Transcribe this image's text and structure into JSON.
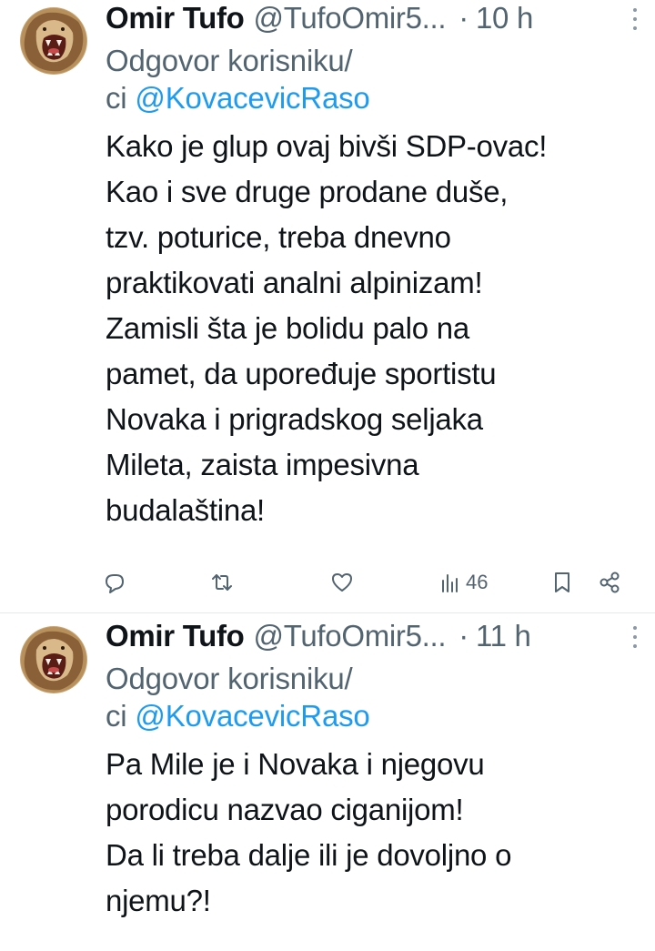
{
  "tweets": [
    {
      "author_name": "Omir Tufo",
      "handle": "@TufoOmir5...",
      "separator": "·",
      "time": "10 h",
      "reply_prefix": "Odgovor korisniku/",
      "reply_prefix2": "ci",
      "reply_mention": "@KovacevicRaso",
      "text": "Kako je glup ovaj bivši SDP-ovac!\nKao i sve druge prodane duše,\ntzv. poturice, treba dnevno\npraktikovati analni alpinizam!\nZamisli šta je bolidu palo na\npamet, da upoređuje sportistu\nNovaka i prigradskog seljaka\nMileta, zaista impesivna\nbudalaština!",
      "views": "46"
    },
    {
      "author_name": "Omir Tufo",
      "handle": "@TufoOmir5...",
      "separator": "·",
      "time": "11 h",
      "reply_prefix": "Odgovor korisniku/",
      "reply_prefix2": "ci",
      "reply_mention": "@KovacevicRaso",
      "text": "Pa Mile je i Novaka i njegovu\nporodicu nazvao ciganijom!\nDa li treba dalje ili je dovoljno o\nnjemu?!"
    }
  ],
  "icons": {
    "reply": "reply-icon",
    "retweet": "retweet-icon",
    "like": "heart-icon",
    "views": "views-icon",
    "bookmark": "bookmark-icon",
    "share": "share-icon",
    "more": "more-icon"
  },
  "colors": {
    "text": "#0f1419",
    "secondary": "#536471",
    "link": "#1d9bf0"
  }
}
